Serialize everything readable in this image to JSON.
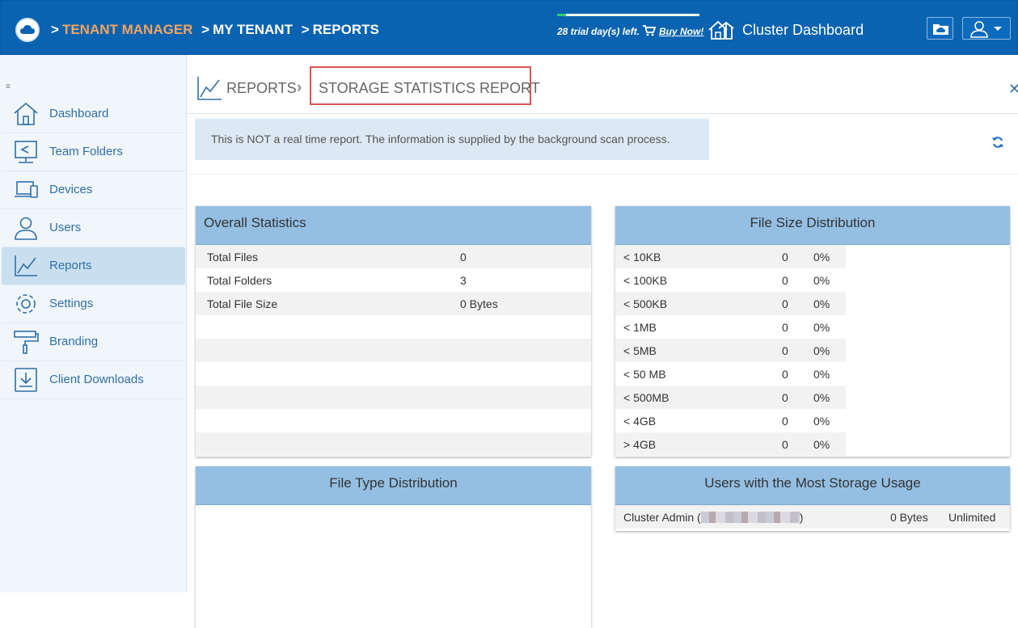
{
  "header": {
    "breadcrumb": [
      "TENANT MANAGER",
      "MY TENANT",
      "REPORTS"
    ],
    "trial_text": "28 trial day(s) left.",
    "trial_progress": 0.06,
    "buy_label": "Buy Now!",
    "cluster_label": "Cluster Dashboard"
  },
  "sidebar": {
    "items": [
      {
        "label": "Dashboard",
        "icon": "home-icon"
      },
      {
        "label": "Team Folders",
        "icon": "team-folder-icon"
      },
      {
        "label": "Devices",
        "icon": "devices-icon"
      },
      {
        "label": "Users",
        "icon": "users-icon"
      },
      {
        "label": "Reports",
        "icon": "reports-chart-icon",
        "active": true
      },
      {
        "label": "Settings",
        "icon": "gear-icon"
      },
      {
        "label": "Branding",
        "icon": "paint-roller-icon"
      },
      {
        "label": "Client Downloads",
        "icon": "download-icon"
      }
    ]
  },
  "page": {
    "parent": "REPORTS",
    "title": "STORAGE STATISTICS REPORT",
    "notice": "This is NOT a real time report. The information is supplied by the background scan process."
  },
  "overall": {
    "title": "Overall Statistics",
    "rows": [
      {
        "label": "Total Files",
        "value": "0"
      },
      {
        "label": "Total Folders",
        "value": "3"
      },
      {
        "label": "Total File Size",
        "value": "0 Bytes"
      }
    ]
  },
  "filesize": {
    "title": "File Size Distribution",
    "rows": [
      {
        "label": "< 10KB",
        "count": "0",
        "pct": "0%"
      },
      {
        "label": "< 100KB",
        "count": "0",
        "pct": "0%"
      },
      {
        "label": "< 500KB",
        "count": "0",
        "pct": "0%"
      },
      {
        "label": "< 1MB",
        "count": "0",
        "pct": "0%"
      },
      {
        "label": "< 5MB",
        "count": "0",
        "pct": "0%"
      },
      {
        "label": "< 50 MB",
        "count": "0",
        "pct": "0%"
      },
      {
        "label": "< 500MB",
        "count": "0",
        "pct": "0%"
      },
      {
        "label": "< 4GB",
        "count": "0",
        "pct": "0%"
      },
      {
        "label": "> 4GB",
        "count": "0",
        "pct": "0%"
      }
    ]
  },
  "filetype": {
    "title": "File Type Distribution"
  },
  "topusers": {
    "title": "Users with the Most Storage Usage",
    "rows": [
      {
        "name_prefix": "Cluster Admin (",
        "name_suffix": ")",
        "usage": "0 Bytes",
        "quota": "Unlimited"
      }
    ]
  }
}
